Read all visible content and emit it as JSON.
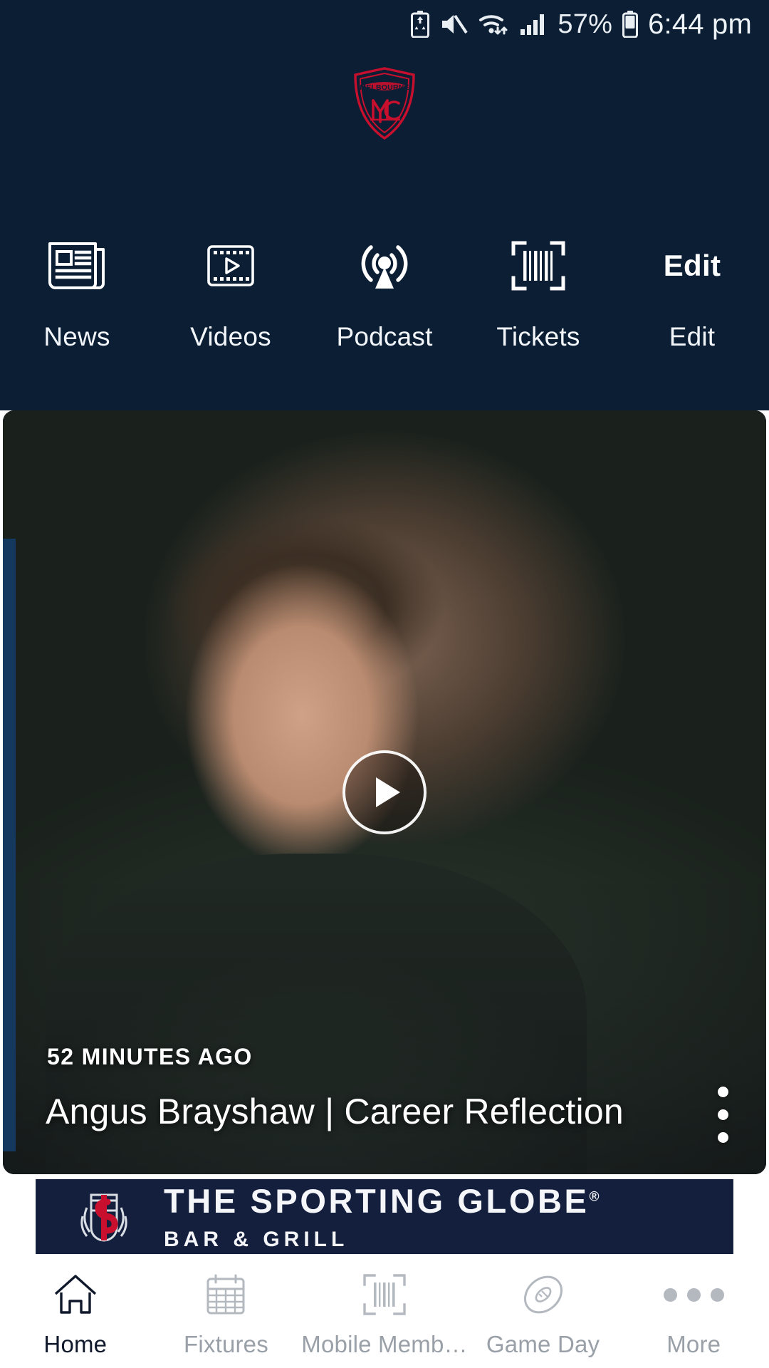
{
  "status_bar": {
    "icons": [
      "battery-saver-icon",
      "mute-icon",
      "wifi-icon",
      "cellular-signal-icon"
    ],
    "battery_percent": "57%",
    "battery_icon": "battery-icon",
    "time": "6:44 pm"
  },
  "header": {
    "background_color": "#0b1e34",
    "logo": {
      "name": "melbourne-football-club-logo",
      "wordmark": "MELBOURNE",
      "monogram": "MFC",
      "primary_color": "#c8102e",
      "secondary_color": "#0b1e34"
    }
  },
  "quick_links": [
    {
      "label": "News",
      "icon": "newspaper-icon"
    },
    {
      "label": "Videos",
      "icon": "film-play-icon"
    },
    {
      "label": "Podcast",
      "icon": "broadcast-antenna-icon"
    },
    {
      "label": "Tickets",
      "icon": "barcode-scan-icon"
    },
    {
      "label": "Edit",
      "icon": "edit-text-icon",
      "glyph": "Edit"
    }
  ],
  "feature_card": {
    "name": "video-story-card",
    "timestamp": "52 MINUTES AGO",
    "title": "Angus Brayshaw | Career Reflection",
    "play_button": "play-icon",
    "overflow_menu": "kebab-menu-icon",
    "accent_color": "#15395e"
  },
  "sponsor_banner": {
    "name": "the-sporting-globe-ad",
    "title": "THE SPORTING GLOBE",
    "registered_mark": "®",
    "subtitle": "BAR & GRILL",
    "background_color": "#141f3d",
    "crest_color": "#c8102e"
  },
  "bottom_nav": [
    {
      "label": "Home",
      "icon": "home-icon",
      "active": true
    },
    {
      "label": "Fixtures",
      "icon": "calendar-icon",
      "active": false
    },
    {
      "label": "Mobile Memb…",
      "icon": "barcode-scan-icon",
      "active": false
    },
    {
      "label": "Game Day",
      "icon": "football-icon",
      "active": false
    },
    {
      "label": "More",
      "icon": "more-dots-icon",
      "active": false
    }
  ]
}
